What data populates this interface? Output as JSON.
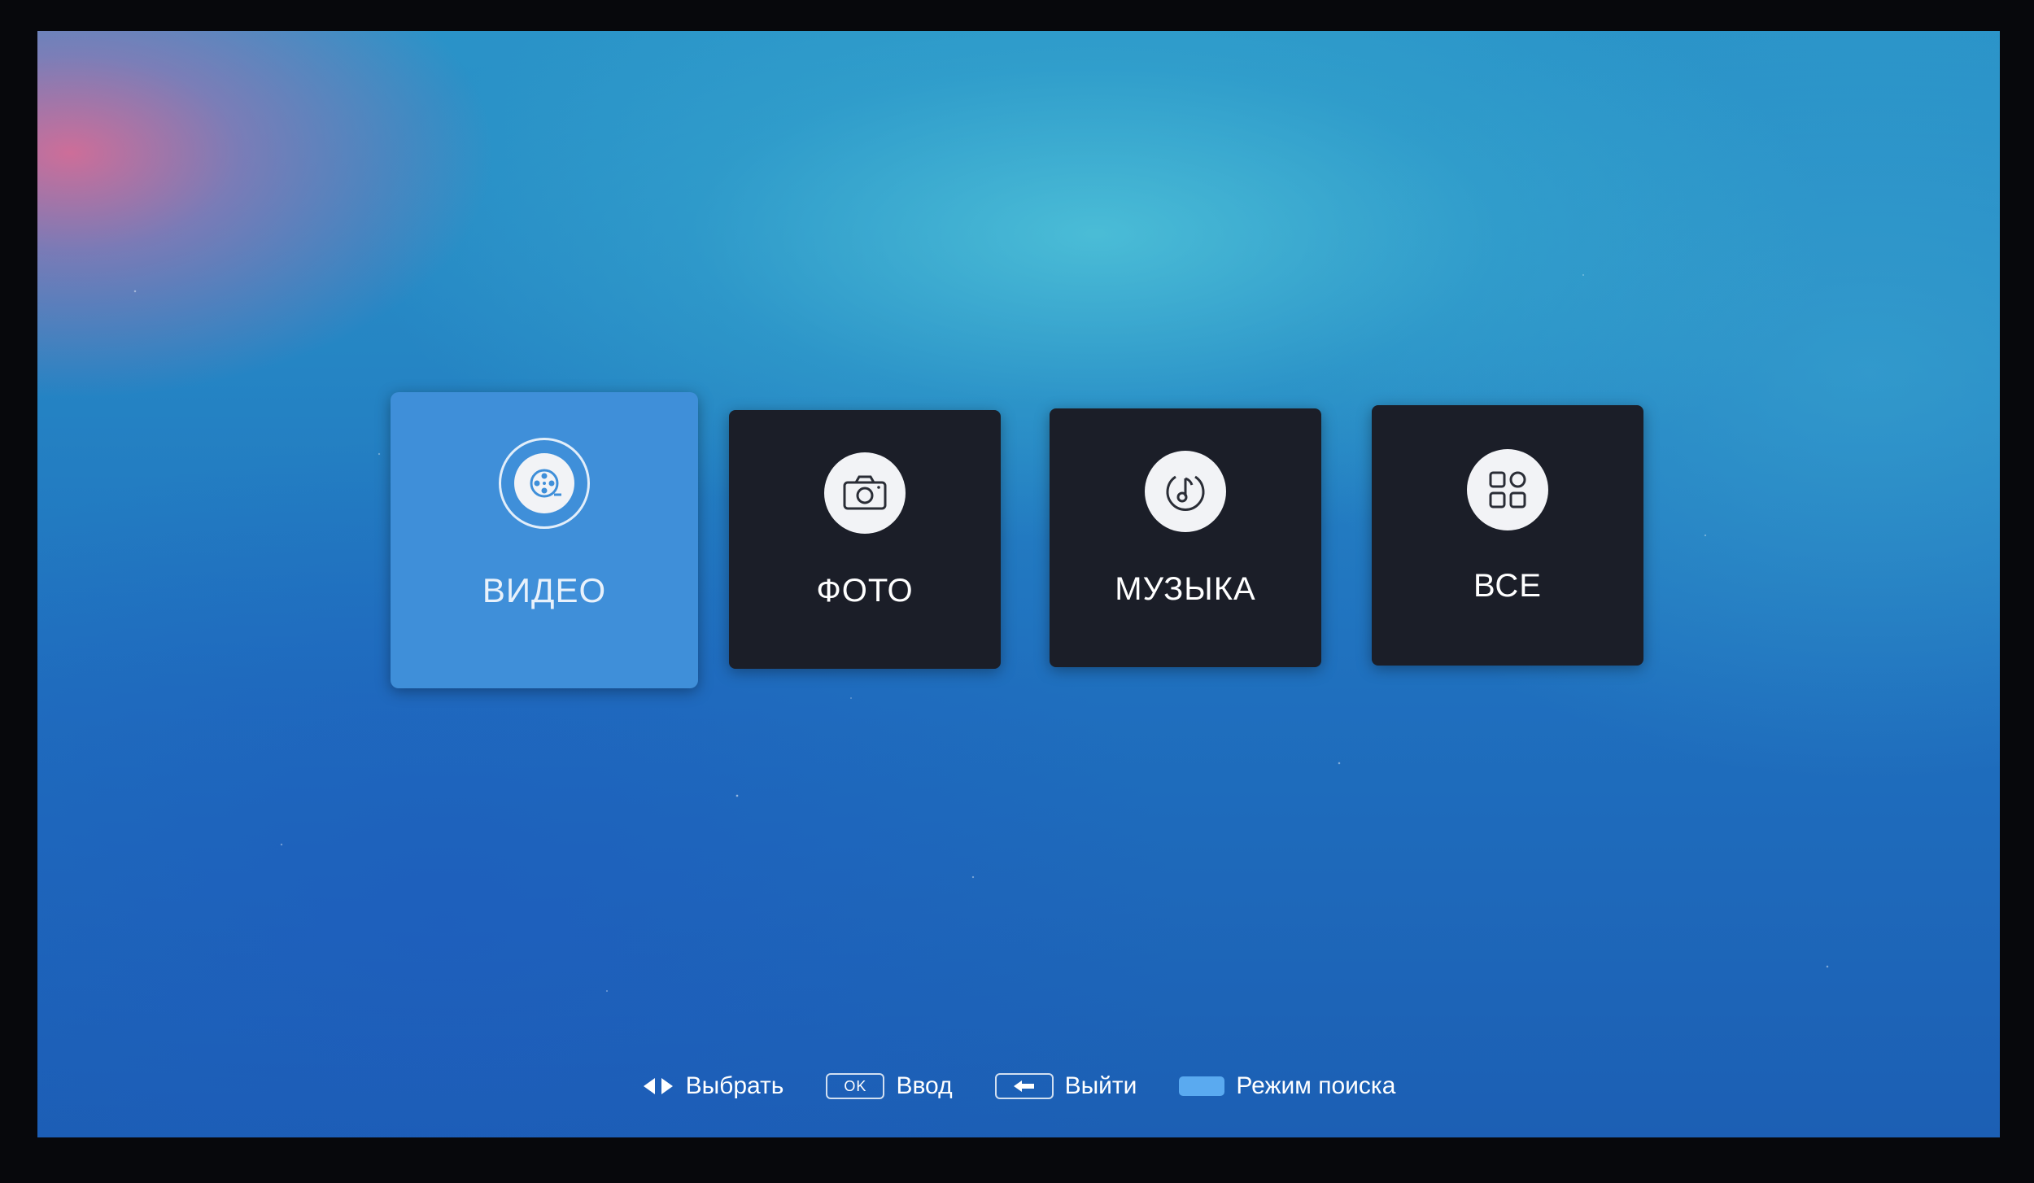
{
  "menu": {
    "tiles": [
      {
        "id": "video",
        "label": "ВИДЕО",
        "icon": "film-reel-icon",
        "selected": true
      },
      {
        "id": "photo",
        "label": "ФОТО",
        "icon": "camera-icon",
        "selected": false
      },
      {
        "id": "music",
        "label": "МУЗЫКА",
        "icon": "music-note-icon",
        "selected": false
      },
      {
        "id": "all",
        "label": "ВСЕ",
        "icon": "grid-apps-icon",
        "selected": false
      }
    ]
  },
  "footer": {
    "select_label": "Выбрать",
    "ok_key": "OK",
    "enter_label": "Ввод",
    "exit_label": "Выйти",
    "search_mode_label": "Режим поиска"
  },
  "colors": {
    "tile_bg": "#1b1e28",
    "tile_selected_bg": "#3f8fd9",
    "blue_key": "#5aaaf0"
  }
}
